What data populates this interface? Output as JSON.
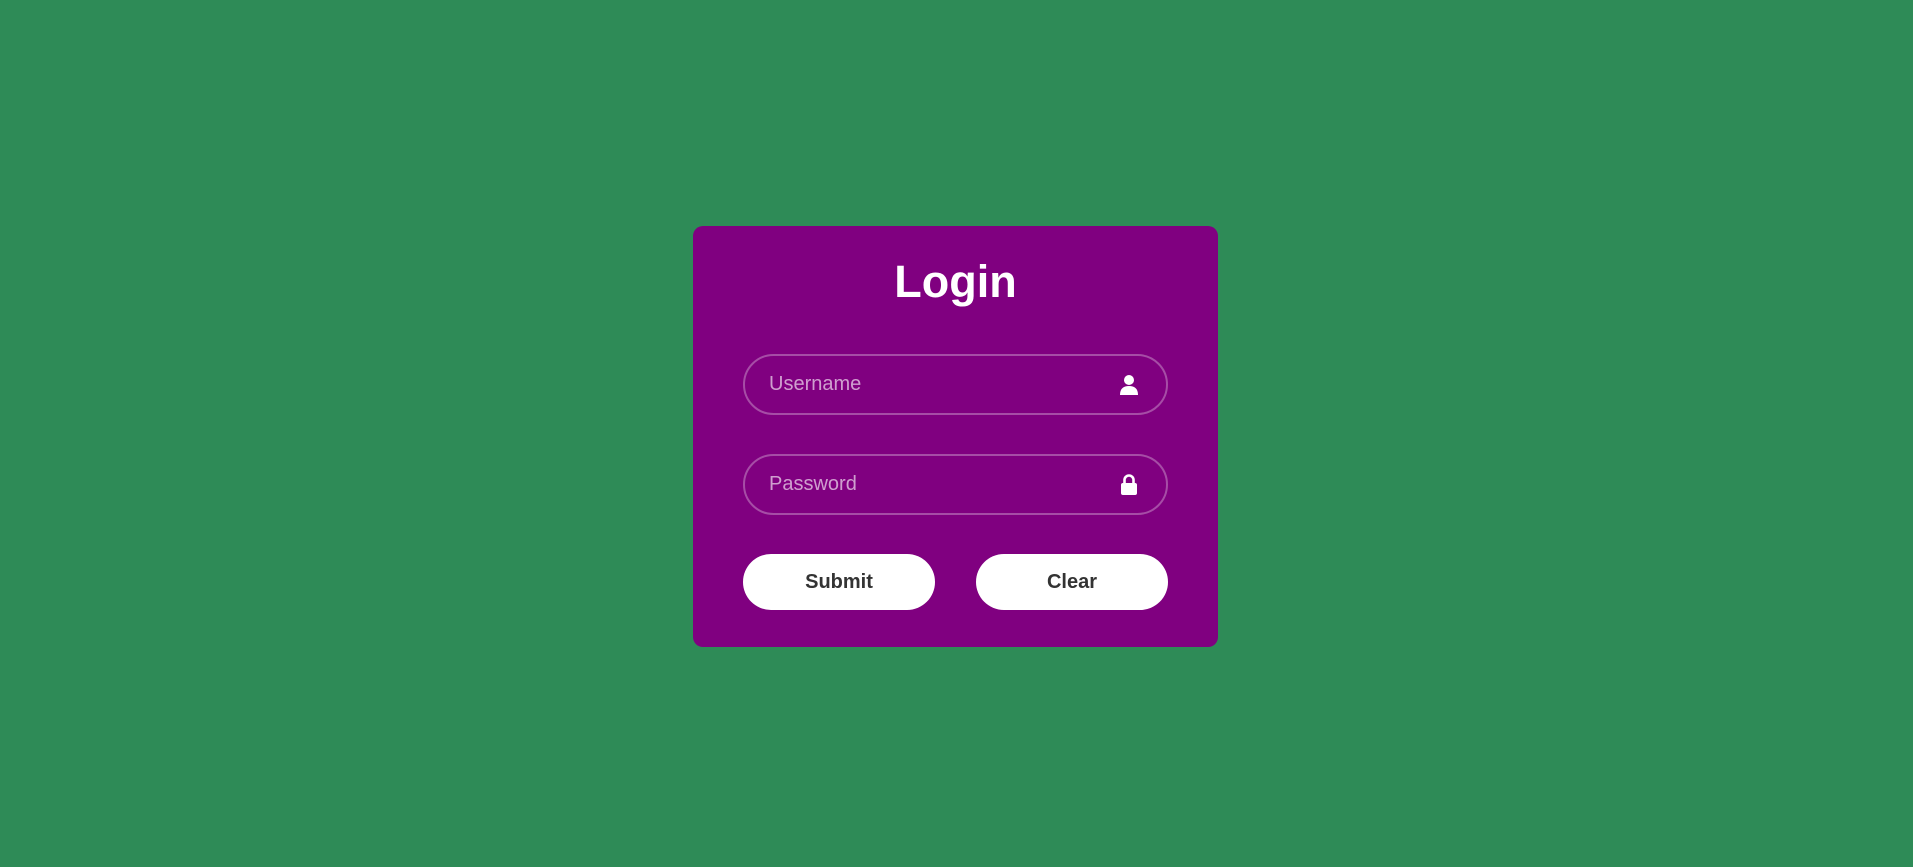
{
  "login_form": {
    "title": "Login",
    "username": {
      "placeholder": "Username",
      "value": "",
      "icon": "user-icon"
    },
    "password": {
      "placeholder": "Password",
      "value": "",
      "icon": "lock-icon"
    },
    "submit_label": "Submit",
    "clear_label": "Clear"
  },
  "colors": {
    "background": "#2e8b57",
    "card": "#800080",
    "button": "#ffffff",
    "button_text": "#333333",
    "text": "#ffffff"
  }
}
